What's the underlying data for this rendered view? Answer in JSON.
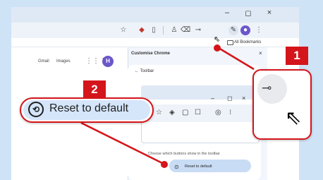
{
  "window": {
    "controls": {
      "minimize": "–",
      "maximize": "◻",
      "close": "×"
    }
  },
  "toolbar": {
    "icons": [
      "star-icon",
      "extension-icon",
      "sidebar-icon",
      "profile-icon",
      "delete-icon",
      "password-key-icon",
      "edit-icon",
      "avatar-icon",
      "menu-icon"
    ]
  },
  "bookmarks": {
    "all_bookmarks_label": "All Bookmarks"
  },
  "page": {
    "gmail_link": "Gmail",
    "images_link": "Images",
    "avatar_letter": "H"
  },
  "panel": {
    "title": "Customise Chrome",
    "close_label": "×",
    "back_label": "← Toolbar",
    "preview_controls": {
      "minimize": "–",
      "maximize": "◻",
      "close": "×"
    },
    "hint_text": "Choose which buttons show in the toolbar",
    "reset_button_label": "Reset to default"
  },
  "callouts": {
    "badge_one": "1",
    "badge_two": "2",
    "reset_zoom_label": "Reset to default",
    "accent_color": "#d4151b"
  }
}
